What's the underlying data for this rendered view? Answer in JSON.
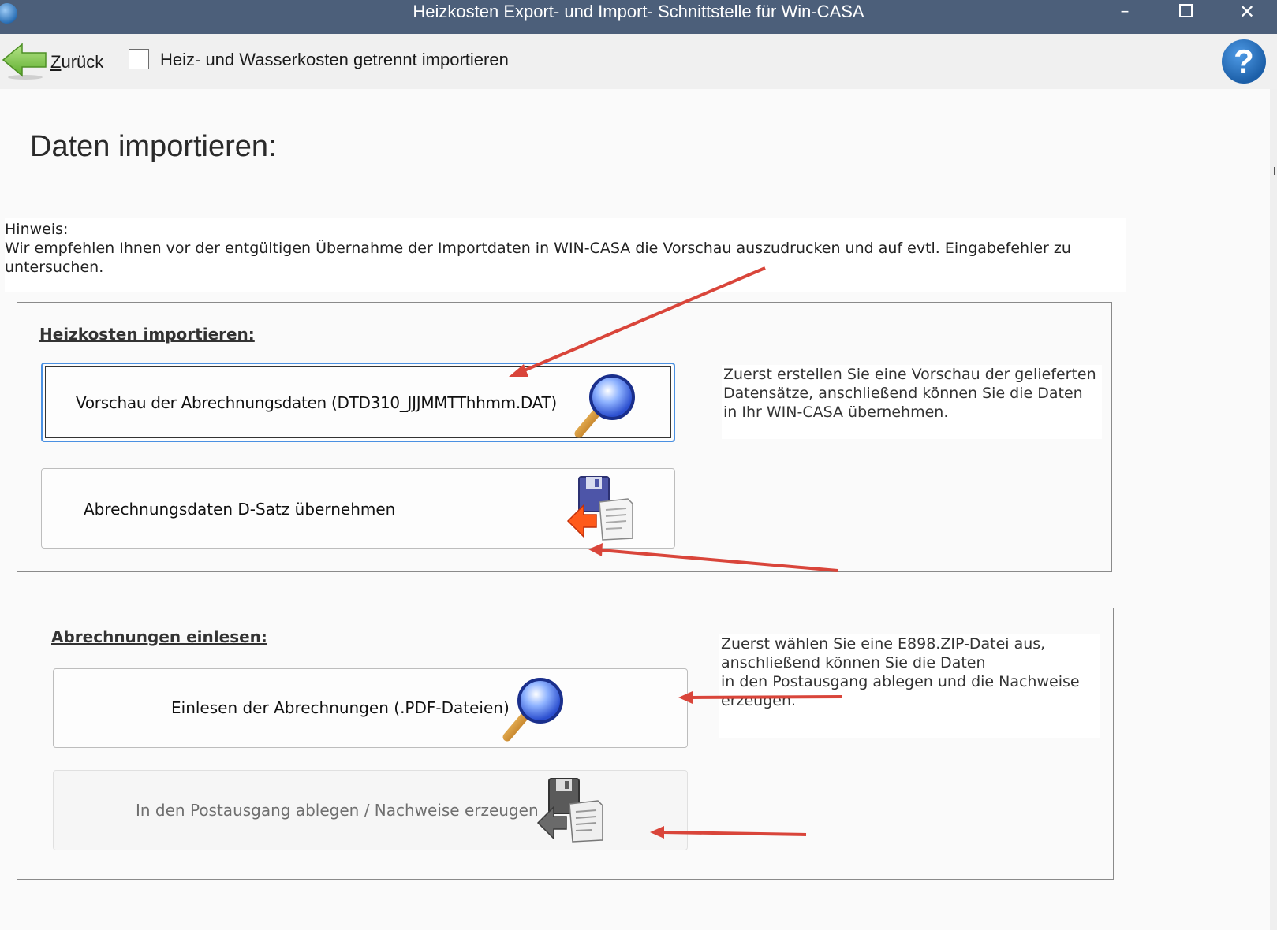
{
  "window": {
    "title": "Heizkosten Export- und Import- Schnittstelle für Win-CASA",
    "minimize": "–",
    "close": "✕"
  },
  "toolbar": {
    "back_label": "Zurück",
    "checkbox_label": "Heiz- und Wasserkosten getrennt importieren",
    "checkbox_checked": false,
    "help": "?"
  },
  "page": {
    "heading": "Daten importieren:"
  },
  "hint": {
    "title": "Hinweis:",
    "text": "Wir empfehlen Ihnen vor der entgültigen Übernahme der Importdaten in WIN-CASA die Vorschau auszudrucken und auf evtl. Eingabefehler zu untersuchen."
  },
  "heizkosten": {
    "title": "Heizkosten importieren:",
    "preview_button": "Vorschau der Abrechnungsdaten (DTD310_JJJMMTThhmm.DAT)",
    "import_button": "Abrechnungsdaten D-Satz übernehmen",
    "description": [
      "Zuerst erstellen Sie eine Vorschau der gelieferten",
      "Datensätze, anschließend können Sie die Daten",
      "in Ihr WIN-CASA übernehmen."
    ]
  },
  "abrechnungen": {
    "title": "Abrechnungen einlesen:",
    "read_button": "Einlesen der Abrechnungen (.PDF-Dateien)",
    "outbox_button": "In den Postausgang ablegen / Nachweise erzeugen",
    "outbox_enabled": false,
    "description": [
      "Zuerst wählen Sie eine E898.ZIP-Datei aus,",
      "anschließend können Sie die Daten",
      "in den Postausgang ablegen und die Nachweise",
      "erzeugen."
    ]
  },
  "colors": {
    "titlebar": "#4c5f7a",
    "toolbar": "#f0f0f0",
    "focus_border": "#4a90e2",
    "annotation_arrow": "#d9453a",
    "help_icon": "#1c5fa8"
  },
  "icons": [
    "app-icon",
    "back-arrow-icon",
    "help-icon",
    "magnifier-icon",
    "disk-import-icon"
  ]
}
